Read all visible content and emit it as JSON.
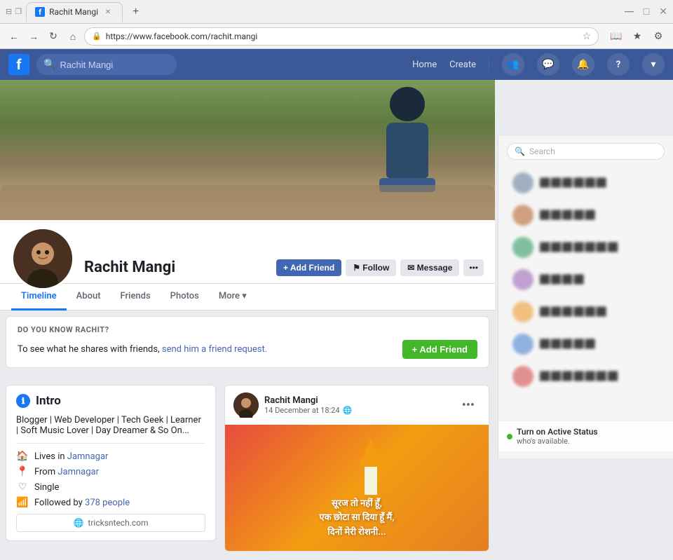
{
  "browser": {
    "tab_title": "Rachit Mangi",
    "url": "https://www.facebook.com/rachit.mangi",
    "new_tab_label": "+",
    "nav_buttons": {
      "back": "←",
      "forward": "→",
      "refresh": "↻",
      "home": "⌂"
    }
  },
  "facebook": {
    "logo": "f",
    "search_placeholder": "Rachit Mangi",
    "nav_items": [
      "Home",
      "Create"
    ],
    "icons": {
      "friends": "👥",
      "messenger": "💬",
      "notifications": "🔔",
      "help": "?",
      "dropdown": "▾"
    }
  },
  "profile": {
    "name": "Rachit Mangi",
    "buttons": {
      "add_friend": "+ Add Friend",
      "follow": "⚑ Follow",
      "message": "✉ Message",
      "more": "•••"
    },
    "tabs": [
      "Timeline",
      "About",
      "Friends",
      "Photos",
      "More ▾"
    ],
    "active_tab": "Timeline"
  },
  "know_rachit": {
    "title": "DO YOU KNOW RACHIT?",
    "text_before_link": "To see what he shares with friends, ",
    "link_text": "send him a friend request.",
    "add_friend_btn": "+ Add Friend"
  },
  "intro": {
    "title": "Intro",
    "bio": "Blogger | Web Developer | Tech Geek | Learner | Soft Music Lover | Day Dreamer & So On...",
    "items": [
      {
        "icon": "🏠",
        "text_before": "Lives in ",
        "link": "Jamnagar",
        "text_after": ""
      },
      {
        "icon": "📍",
        "text_before": "From ",
        "link": "Jamnagar",
        "text_after": ""
      },
      {
        "icon": "♡",
        "text": "Single",
        "type": "plain"
      },
      {
        "icon": "📶",
        "text_before": "Followed by ",
        "link": "378 people",
        "text_after": ""
      }
    ],
    "website": "tricksntech.com"
  },
  "post": {
    "author": "Rachit Mangi",
    "time": "14 December at 18:24",
    "globe_icon": "🌐",
    "more_icon": "•••",
    "hindi_lines": [
      "सूरज तो नहीं हूँ,",
      "एक छोटा सा दिया हूँ मैं,",
      "दिनों मेरी रोशनी..."
    ]
  },
  "sidebar": {
    "search_placeholder": "Search",
    "active_status_text": "Turn on Active Status",
    "active_status_sub": "who's available.",
    "chat_items": []
  }
}
